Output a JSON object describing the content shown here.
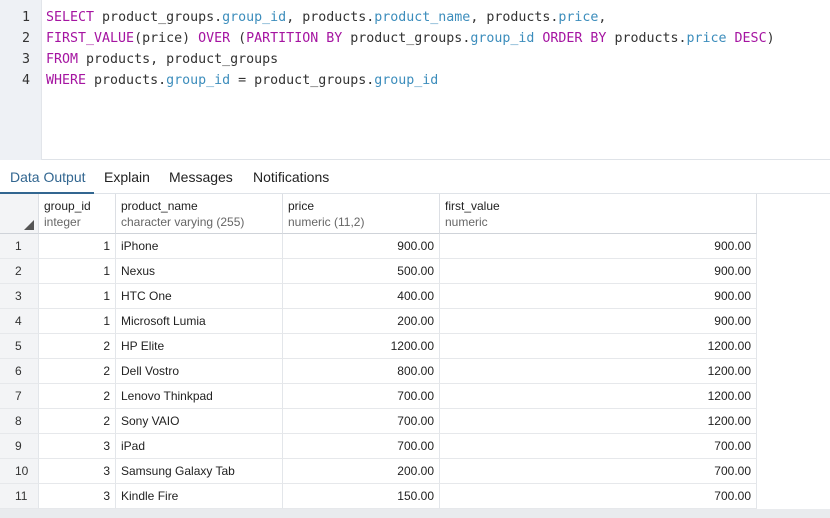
{
  "editor": {
    "line_numbers": [
      "1",
      "2",
      "3",
      "4"
    ],
    "lines": [
      [
        {
          "t": "SELECT",
          "c": "kw"
        },
        {
          "t": " product_groups.",
          "c": ""
        },
        {
          "t": "group_id",
          "c": "fld"
        },
        {
          "t": ", products.",
          "c": ""
        },
        {
          "t": "product_name",
          "c": "fld"
        },
        {
          "t": ", products.",
          "c": ""
        },
        {
          "t": "price",
          "c": "fld"
        },
        {
          "t": ",",
          "c": ""
        }
      ],
      [
        {
          "t": "FIRST_VALUE",
          "c": "kw"
        },
        {
          "t": "(price) ",
          "c": ""
        },
        {
          "t": "OVER",
          "c": "kw"
        },
        {
          "t": " (",
          "c": ""
        },
        {
          "t": "PARTITION BY",
          "c": "kw"
        },
        {
          "t": " product_groups.",
          "c": ""
        },
        {
          "t": "group_id",
          "c": "fld"
        },
        {
          "t": " ",
          "c": ""
        },
        {
          "t": "ORDER BY",
          "c": "kw"
        },
        {
          "t": " products.",
          "c": ""
        },
        {
          "t": "price",
          "c": "fld"
        },
        {
          "t": " ",
          "c": ""
        },
        {
          "t": "DESC",
          "c": "kw"
        },
        {
          "t": ")",
          "c": ""
        }
      ],
      [
        {
          "t": "FROM",
          "c": "kw"
        },
        {
          "t": " products, product_groups",
          "c": ""
        }
      ],
      [
        {
          "t": "WHERE",
          "c": "kw"
        },
        {
          "t": " products.",
          "c": ""
        },
        {
          "t": "group_id",
          "c": "fld"
        },
        {
          "t": " = product_groups.",
          "c": ""
        },
        {
          "t": "group_id",
          "c": "fld"
        }
      ]
    ]
  },
  "tabs": [
    "Data Output",
    "Explain",
    "Messages",
    "Notifications"
  ],
  "active_tab": "Data Output",
  "table": {
    "columns": [
      {
        "name": "group_id",
        "type": "integer"
      },
      {
        "name": "product_name",
        "type": "character varying (255)"
      },
      {
        "name": "price",
        "type": "numeric (11,2)"
      },
      {
        "name": "first_value",
        "type": "numeric"
      }
    ],
    "rows": [
      [
        "1",
        "1",
        "iPhone",
        "900.00",
        "900.00"
      ],
      [
        "2",
        "1",
        "Nexus",
        "500.00",
        "900.00"
      ],
      [
        "3",
        "1",
        "HTC One",
        "400.00",
        "900.00"
      ],
      [
        "4",
        "1",
        "Microsoft Lumia",
        "200.00",
        "900.00"
      ],
      [
        "5",
        "2",
        "HP Elite",
        "1200.00",
        "1200.00"
      ],
      [
        "6",
        "2",
        "Dell Vostro",
        "800.00",
        "1200.00"
      ],
      [
        "7",
        "2",
        "Lenovo Thinkpad",
        "700.00",
        "1200.00"
      ],
      [
        "8",
        "2",
        "Sony VAIO",
        "700.00",
        "1200.00"
      ],
      [
        "9",
        "3",
        "iPad",
        "700.00",
        "700.00"
      ],
      [
        "10",
        "3",
        "Samsung Galaxy Tab",
        "200.00",
        "700.00"
      ],
      [
        "11",
        "3",
        "Kindle Fire",
        "150.00",
        "700.00"
      ]
    ]
  },
  "colors": {
    "keyword": "#a514a1",
    "field": "#3c8dbc",
    "active_tab": "#326690"
  }
}
